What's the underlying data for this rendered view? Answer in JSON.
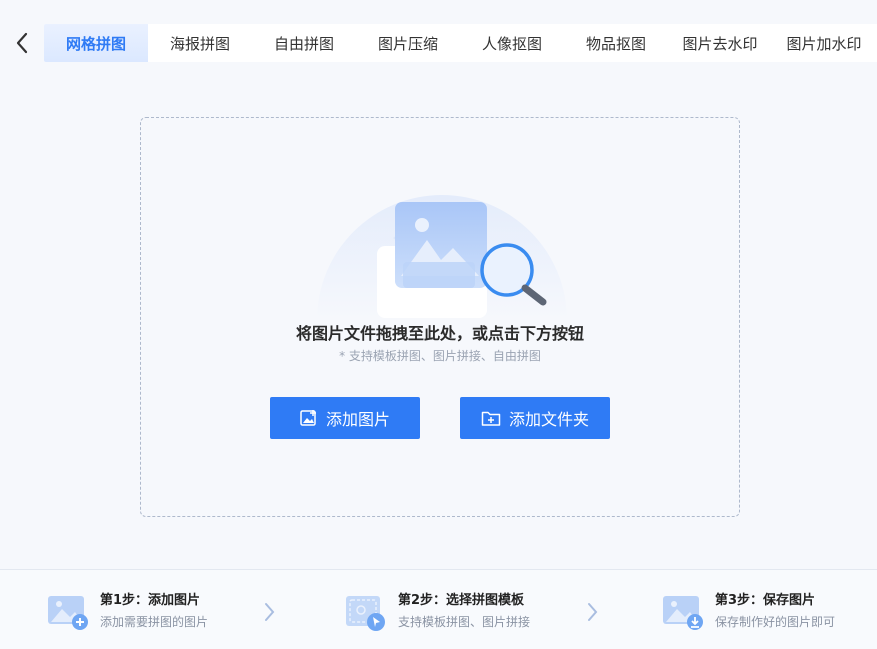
{
  "nav": {
    "back_icon": "chevron-left-icon",
    "tabs": [
      {
        "label": "网格拼图",
        "active": true
      },
      {
        "label": "海报拼图",
        "active": false
      },
      {
        "label": "自由拼图",
        "active": false
      },
      {
        "label": "图片压缩",
        "active": false
      },
      {
        "label": "人像抠图",
        "active": false
      },
      {
        "label": "物品抠图",
        "active": false
      },
      {
        "label": "图片去水印",
        "active": false
      },
      {
        "label": "图片加水印",
        "active": false
      }
    ]
  },
  "dropzone": {
    "title": "将图片文件拖拽至此处，或点击下方按钮",
    "subtitle": "* 支持模板拼图、图片拼接、自由拼图",
    "add_image_label": "添加图片",
    "add_folder_label": "添加文件夹"
  },
  "steps": [
    {
      "title": "第1步：添加图片",
      "desc": "添加需要拼图的图片",
      "icon": "add-image-icon"
    },
    {
      "title": "第2步：选择拼图模板",
      "desc": "支持模板拼图、图片拼接",
      "icon": "template-select-icon"
    },
    {
      "title": "第3步：保存图片",
      "desc": "保存制作好的图片即可",
      "icon": "save-image-icon"
    }
  ],
  "colors": {
    "accent": "#2f7bf5",
    "background": "#f6f8fc",
    "active_tab_bg": "#dbe8ff"
  }
}
